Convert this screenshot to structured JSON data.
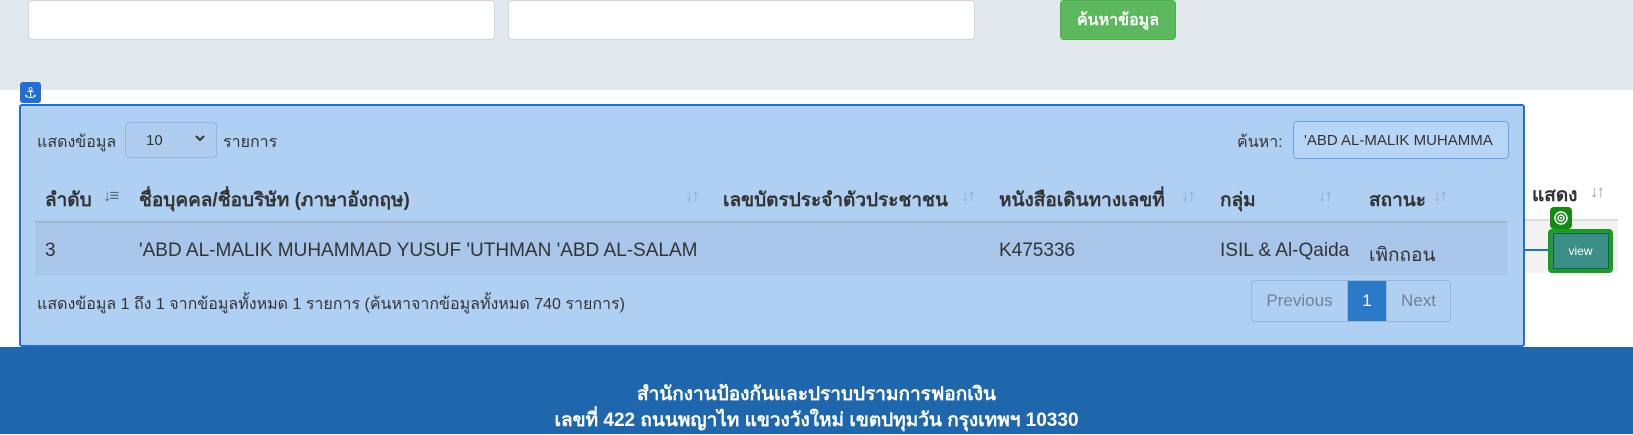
{
  "search": {
    "input1_value": "",
    "input2_value": "",
    "button_label": "ค้นหาข้อมูล"
  },
  "anchor_icon": "anchor-icon",
  "table_controls": {
    "length_prefix": "แสดงข้อมูล",
    "length_value": "10",
    "length_suffix": "รายการ",
    "filter_label": "ค้นหา:",
    "filter_value": "'ABD AL-MALIK MUHAMMA"
  },
  "table": {
    "columns": [
      {
        "label": "ลำดับ"
      },
      {
        "label": "ชื่อบุคคล/ชื่อบริษัท (ภาษาอังกฤษ)"
      },
      {
        "label": "เลขบัตรประจำตัวประชาชน"
      },
      {
        "label": "หนังสือเดินทางเลขที่"
      },
      {
        "label": "กลุ่ม"
      },
      {
        "label": "สถานะ"
      },
      {
        "label": "แสดง"
      }
    ],
    "rows": [
      {
        "no": "3",
        "name": "'ABD AL-MALIK MUHAMMAD YUSUF 'UTHMAN 'ABD AL-SALAM",
        "id_card": "",
        "passport": "K475336",
        "group": "ISIL & Al-Qaida",
        "status": "เพิกถอน",
        "view_label": "view"
      }
    ],
    "sort_icon": "sort-arrows-icon"
  },
  "info_text": "แสดงข้อมูล 1 ถึง 1 จากข้อมูลทั้งหมด 1 รายการ (ค้นหาจากข้อมูลทั้งหมด 740 รายการ)",
  "pagination": {
    "previous": "Previous",
    "current": "1",
    "next": "Next"
  },
  "footer": {
    "line1": "สำนักงานป้องกันและปราบปรามการฟอกเงิน",
    "line2": "เลขที่ 422 ถนนพญาไท แขวงวังใหม่ เขตปทุมวัน กรุงเทพฯ 10330"
  },
  "colors": {
    "panel_bg": "#b0d0f3",
    "highlight_border": "#1f6fd8",
    "footer_bg": "#1f67ad",
    "search_button": "#5cb85c",
    "pager_active": "#2a7ac8"
  }
}
